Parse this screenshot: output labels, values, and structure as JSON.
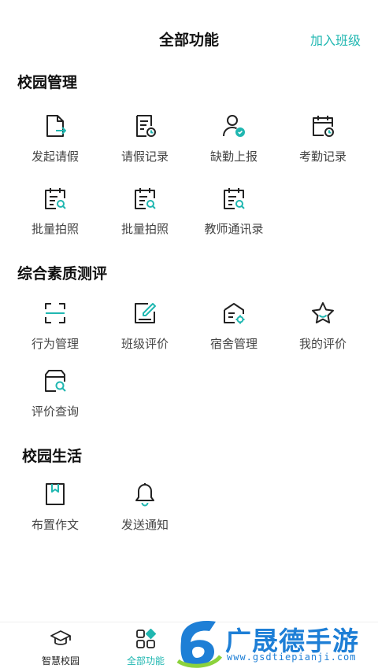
{
  "header": {
    "title": "全部功能",
    "join_label": "加入班级"
  },
  "sections": [
    {
      "title": "校园管理",
      "items": [
        {
          "label": "发起请假",
          "icon": "leave-request-icon"
        },
        {
          "label": "请假记录",
          "icon": "leave-record-icon"
        },
        {
          "label": "缺勤上报",
          "icon": "absence-report-icon"
        },
        {
          "label": "考勤记录",
          "icon": "attendance-record-icon"
        },
        {
          "label": "批量拍照",
          "icon": "batch-photo-icon"
        },
        {
          "label": "批量拍照",
          "icon": "batch-photo-icon"
        },
        {
          "label": "教师通讯录",
          "icon": "teacher-contacts-icon"
        }
      ]
    },
    {
      "title": "综合素质测评",
      "items": [
        {
          "label": "行为管理",
          "icon": "scan-icon"
        },
        {
          "label": "班级评价",
          "icon": "edit-icon"
        },
        {
          "label": "宿舍管理",
          "icon": "dorm-icon"
        },
        {
          "label": "我的评价",
          "icon": "star-icon"
        },
        {
          "label": "评价查询",
          "icon": "search-box-icon"
        }
      ]
    },
    {
      "title": "校园生活",
      "items": [
        {
          "label": "布置作文",
          "icon": "bookmark-icon"
        },
        {
          "label": "发送通知",
          "icon": "bell-icon"
        }
      ]
    }
  ],
  "tabbar": {
    "tabs": [
      {
        "label": "智慧校园",
        "icon": "graduation-cap-icon",
        "active": false
      },
      {
        "label": "全部功能",
        "icon": "grid-icon",
        "active": true
      }
    ]
  },
  "watermark": {
    "text": "广晟德手游",
    "url": "www.gsdtiepianji.com"
  },
  "colors": {
    "accent": "#20b7b1",
    "text": "#222222",
    "watermark": "#1e7fd6"
  }
}
